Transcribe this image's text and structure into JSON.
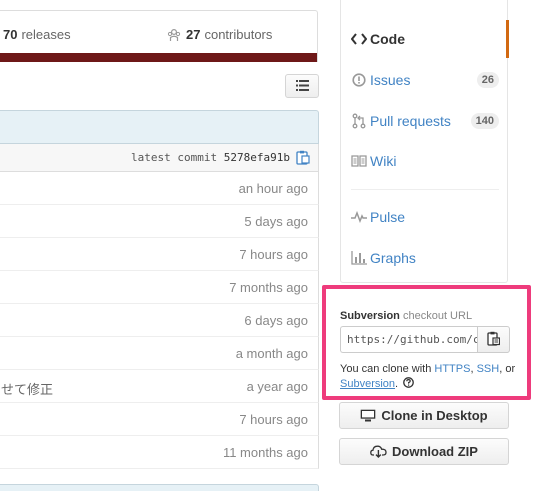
{
  "stats": {
    "releases_count": "70",
    "releases_label": "releases",
    "contributors_count": "27",
    "contributors_label": "contributors"
  },
  "commit": {
    "latest_label": "latest commit",
    "sha": "5278efa91b"
  },
  "files": [
    {
      "message": "",
      "age": "an hour ago"
    },
    {
      "message": "",
      "age": "5 days ago"
    },
    {
      "message": "",
      "age": "7 hours ago"
    },
    {
      "message": "",
      "age": "7 months ago"
    },
    {
      "message": "",
      "age": "6 days ago"
    },
    {
      "message": "",
      "age": "a month ago"
    },
    {
      "message": "せて修正",
      "age": "a year ago"
    },
    {
      "message": "",
      "age": "7 hours ago"
    },
    {
      "message": "",
      "age": "11 months ago"
    }
  ],
  "nav": {
    "code": "Code",
    "issues": "Issues",
    "issues_count": "26",
    "pulls": "Pull requests",
    "pulls_count": "140",
    "wiki": "Wiki",
    "pulse": "Pulse",
    "graphs": "Graphs"
  },
  "clone": {
    "protocol": "Subversion",
    "title_suffix": "checkout URL",
    "url": "https://github.com/c",
    "help_prefix": "You can clone with",
    "https": "HTTPS",
    "ssh": "SSH",
    "or": "or",
    "subversion": "Subversion"
  },
  "buttons": {
    "desktop": "Clone in Desktop",
    "zip": "Download ZIP"
  },
  "colors": {
    "accent_pink": "#ee3b7c",
    "link_blue": "#4183c4",
    "selected_orange": "#d26911",
    "language_bar": "#6e1818"
  }
}
